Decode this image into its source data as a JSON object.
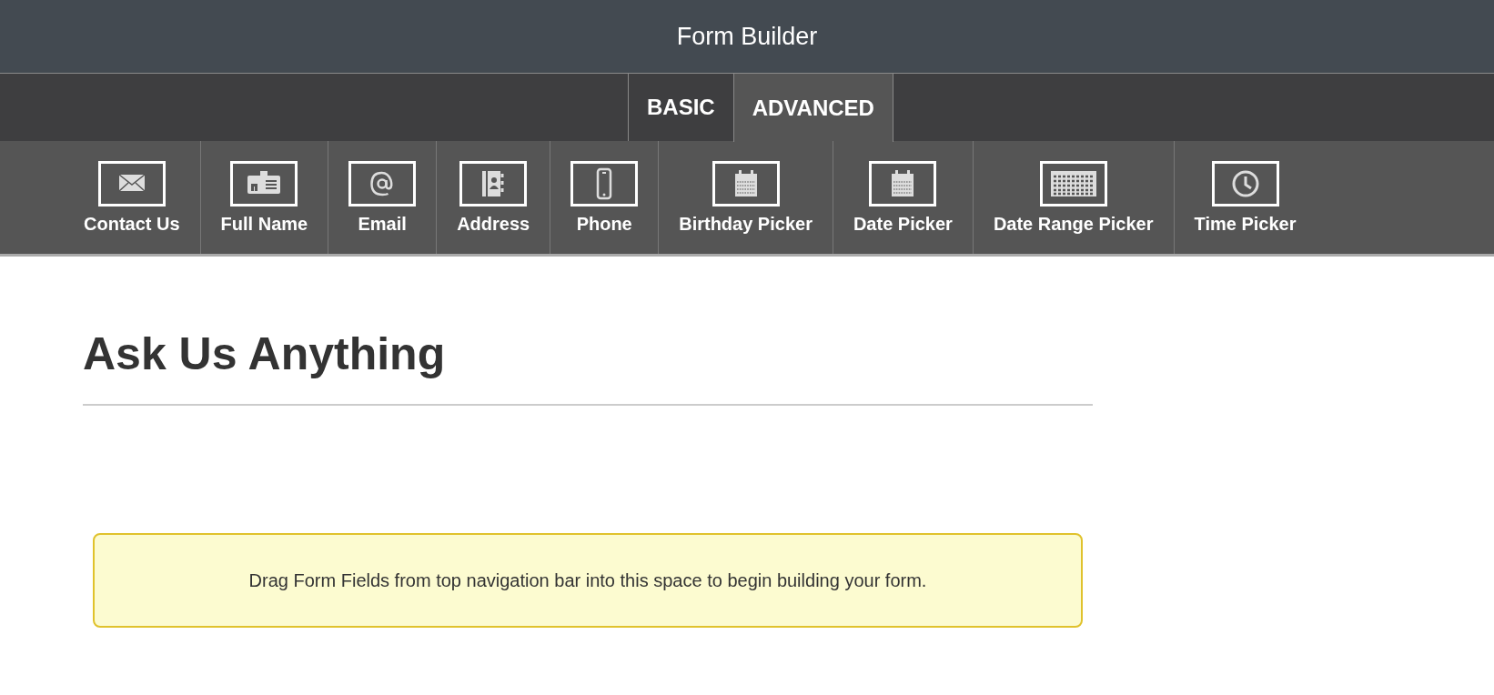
{
  "window": {
    "title": "Form Builder"
  },
  "tabs": [
    {
      "label": "BASIC",
      "selected": false
    },
    {
      "label": "ADVANCED",
      "selected": true
    }
  ],
  "fields": [
    {
      "label": "Contact Us",
      "kind": "envelope"
    },
    {
      "label": "Full Name",
      "kind": "idcard"
    },
    {
      "label": "Email",
      "kind": "at"
    },
    {
      "label": "Address",
      "kind": "contacts"
    },
    {
      "label": "Phone",
      "kind": "phone"
    },
    {
      "label": "Birthday Picker",
      "kind": "calendar"
    },
    {
      "label": "Date Picker",
      "kind": "calendar"
    },
    {
      "label": "Date Range Picker",
      "kind": "calgrid"
    },
    {
      "label": "Time Picker",
      "kind": "clock"
    }
  ],
  "form": {
    "title": "Ask Us Anything",
    "notice": "Drag Form Fields from top navigation bar into this space to begin building your form."
  }
}
